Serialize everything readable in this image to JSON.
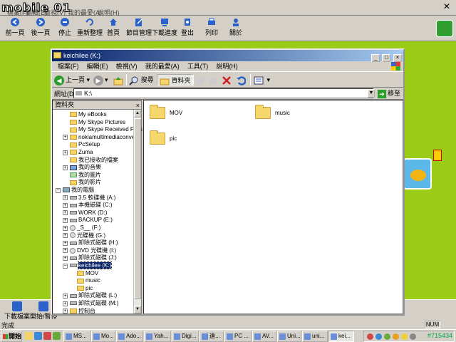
{
  "outer": {
    "logo": "mobile 01",
    "menu_faint": [
      "檔案(F)",
      "編輯(E)",
      "檢視(V)",
      "我的最愛(A)",
      "說明(H)"
    ],
    "close_label": "✕",
    "toolbar": [
      {
        "label": "前一頁",
        "icon": "back-arrow-icon"
      },
      {
        "label": "後一頁",
        "icon": "forward-arrow-icon"
      },
      {
        "label": "停止",
        "icon": "stop-icon"
      },
      {
        "label": "重新整理",
        "icon": "refresh-icon"
      },
      {
        "label": "首頁",
        "icon": "home-icon"
      },
      {
        "label": "節目管理",
        "icon": "edit-icon"
      },
      {
        "label": "下載進度",
        "icon": "download-icon"
      },
      {
        "label": "登出",
        "icon": "logout-icon"
      },
      {
        "label": "列印",
        "icon": "print-icon"
      },
      {
        "label": "關於",
        "icon": "about-icon"
      }
    ],
    "bottom_toolbar": [
      {
        "label": "下載檔案",
        "icon": "download-file-icon"
      },
      {
        "label": "開始/暫停",
        "icon": "play-pause-icon"
      }
    ],
    "status_text": "完成",
    "status_num": "NUM"
  },
  "taskbar": {
    "start_label": "開始",
    "tasks": [
      "MS...",
      "Mo...",
      "Ado...",
      "Yah...",
      "Digi...",
      "遠...",
      "PC ...",
      "AV...",
      "Uni...",
      "uni...",
      "kei..."
    ],
    "active_task": "kei...",
    "clock": "#715434"
  },
  "explorer": {
    "title": "keichilee (K:)",
    "menu": [
      "檔案(F)",
      "編輯(E)",
      "檢視(V)",
      "我的最愛(A)",
      "工具(T)",
      "說明(H)"
    ],
    "toolbar": {
      "back": "上一頁",
      "search": "搜尋",
      "folders": "資料夾"
    },
    "address_label": "網址(D)",
    "address_value": "K:\\",
    "go_label": "移至",
    "folder_pane_title": "資料夾",
    "tree": [
      {
        "label": "My eBooks",
        "icon": "folder",
        "indent": 2,
        "expander": ""
      },
      {
        "label": "My Skype Pictures",
        "icon": "folder",
        "indent": 2,
        "expander": ""
      },
      {
        "label": "My Skype Received Files",
        "icon": "folder",
        "indent": 2,
        "expander": ""
      },
      {
        "label": "nokiamultimediaconverte",
        "icon": "folder",
        "indent": 2,
        "expander": "+"
      },
      {
        "label": "PcSetup",
        "icon": "folder",
        "indent": 2,
        "expander": ""
      },
      {
        "label": "Zuma",
        "icon": "folder",
        "indent": 2,
        "expander": "+"
      },
      {
        "label": "我已接收的檔案",
        "icon": "folder",
        "indent": 2,
        "expander": ""
      },
      {
        "label": "我的音樂",
        "icon": "music",
        "indent": 2,
        "expander": "+"
      },
      {
        "label": "我的圖片",
        "icon": "pic",
        "indent": 2,
        "expander": ""
      },
      {
        "label": "我的影片",
        "icon": "folder",
        "indent": 2,
        "expander": ""
      },
      {
        "label": "我的電腦",
        "icon": "pc",
        "indent": 1,
        "expander": "-"
      },
      {
        "label": "3.5 軟碟機 (A:)",
        "icon": "drive",
        "indent": 2,
        "expander": "+"
      },
      {
        "label": "本機磁碟 (C:)",
        "icon": "drive",
        "indent": 2,
        "expander": "+"
      },
      {
        "label": "WORK (D:)",
        "icon": "drive",
        "indent": 2,
        "expander": "+"
      },
      {
        "label": "BACKUP (E:)",
        "icon": "drive",
        "indent": 2,
        "expander": "+"
      },
      {
        "label": "_S__ (F:)",
        "icon": "cd",
        "indent": 2,
        "expander": "+"
      },
      {
        "label": "光碟機 (G:)",
        "icon": "cd",
        "indent": 2,
        "expander": "+"
      },
      {
        "label": "卸除式磁碟 (H:)",
        "icon": "drive",
        "indent": 2,
        "expander": "+"
      },
      {
        "label": "DVD 光碟機 (I:)",
        "icon": "cd",
        "indent": 2,
        "expander": "+"
      },
      {
        "label": "卸除式磁碟 (J:)",
        "icon": "drive",
        "indent": 2,
        "expander": "+"
      },
      {
        "label": "keichilee (K:)",
        "icon": "drive",
        "indent": 2,
        "expander": "-",
        "selected": true
      },
      {
        "label": "MOV",
        "icon": "folder",
        "indent": 3,
        "expander": ""
      },
      {
        "label": "music",
        "icon": "folder",
        "indent": 3,
        "expander": ""
      },
      {
        "label": "pic",
        "icon": "folder",
        "indent": 3,
        "expander": ""
      },
      {
        "label": "卸除式磁碟 (L:)",
        "icon": "drive",
        "indent": 2,
        "expander": "+"
      },
      {
        "label": "卸除式磁碟 (M:)",
        "icon": "drive",
        "indent": 2,
        "expander": "+"
      },
      {
        "label": "控制台",
        "icon": "folder",
        "indent": 2,
        "expander": "+"
      }
    ],
    "content_folders": [
      "MOV",
      "music",
      "pic"
    ]
  }
}
